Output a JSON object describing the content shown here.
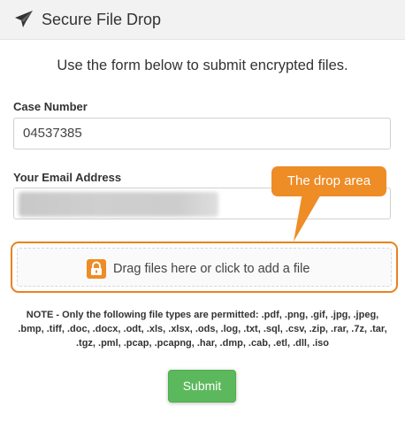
{
  "header": {
    "title": "Secure File Drop",
    "icon": "paper-plane-icon"
  },
  "intro": "Use the form below to submit encrypted files.",
  "case_number": {
    "label": "Case Number",
    "value": "04537385"
  },
  "email": {
    "label": "Your Email Address",
    "value": ""
  },
  "drop_area": {
    "icon": "lock-icon",
    "text": "Drag files here or click to add a file"
  },
  "callout": {
    "text": "The drop area"
  },
  "note": "NOTE - Only the following file types are permitted: .pdf, .png, .gif, .jpg, .jpeg, .bmp, .tiff, .doc, .docx, .odt, .xls, .xlsx, .ods, .log, .txt, .sql, .csv, .zip, .rar, .7z, .tar, .tgz, .pml, .pcap, .pcapng, .har, .dmp, .cab, .etl, .dll, .iso",
  "submit": {
    "label": "Submit"
  },
  "colors": {
    "accent_orange": "#ee8c26",
    "submit_green": "#5cb85c",
    "header_bg": "#f2f2f2"
  }
}
